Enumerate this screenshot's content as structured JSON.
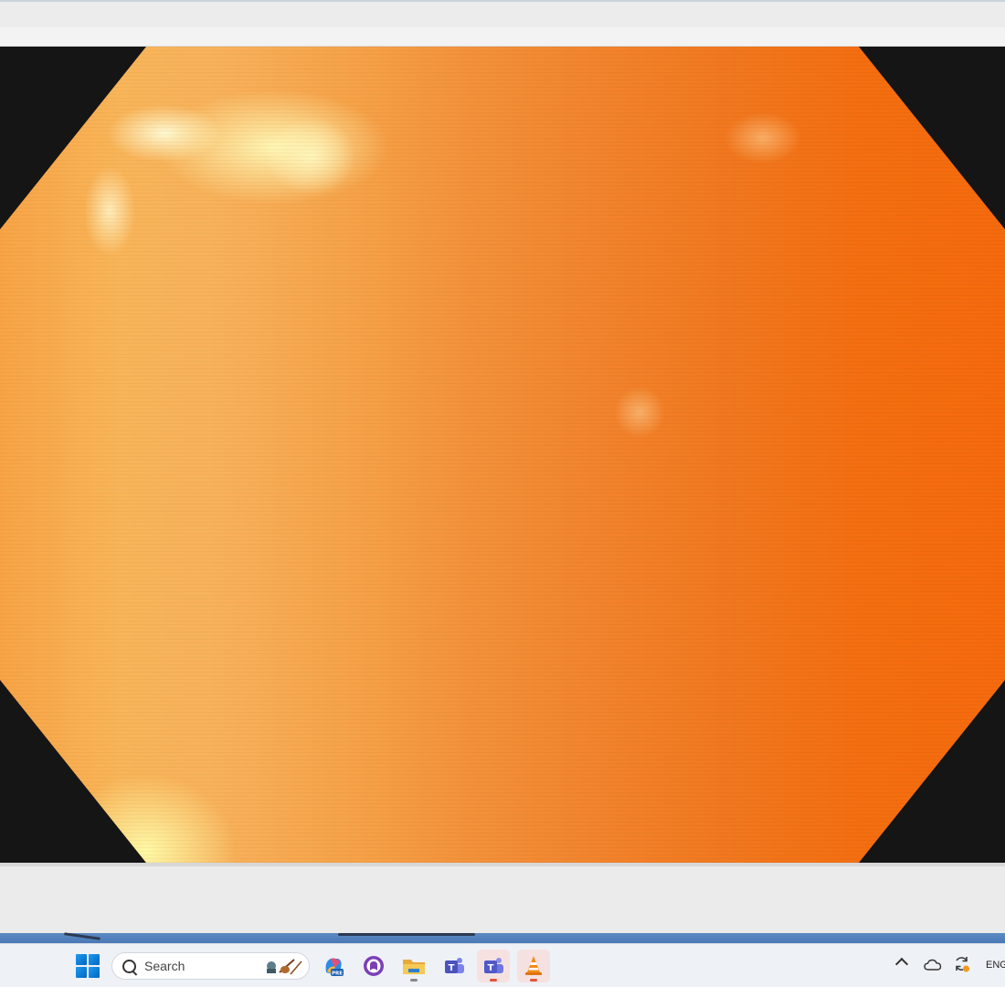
{
  "app": {
    "name": "VLC media player"
  },
  "taskbar": {
    "search": {
      "label": "Search"
    },
    "apps": [
      {
        "name": "copilot-pre",
        "icon": "copilot-icon",
        "badge": "PRE"
      },
      {
        "name": "github-desktop",
        "icon": "github-icon"
      },
      {
        "name": "file-explorer",
        "icon": "folder-icon"
      },
      {
        "name": "teams-classic",
        "icon": "teams-icon"
      },
      {
        "name": "teams-new",
        "icon": "teams-icon"
      },
      {
        "name": "vlc",
        "icon": "vlc-cone-icon"
      }
    ],
    "tray": {
      "language": "ENG"
    }
  },
  "colors": {
    "accent": "#0067c0",
    "video_dominant": "#f56a0d",
    "video_highlight": "#fff2a8",
    "letterbox": "#151515"
  }
}
